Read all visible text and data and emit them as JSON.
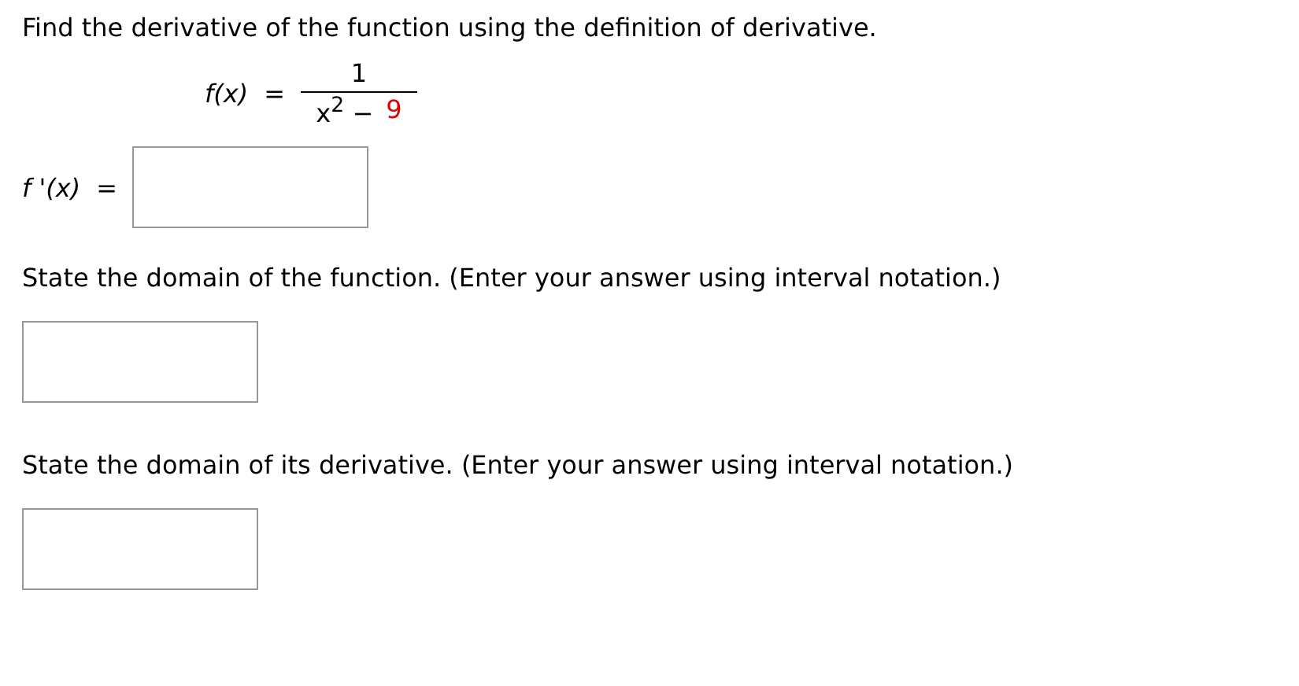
{
  "instruction": "Find the derivative of the function using the definition of derivative.",
  "function": {
    "lhs": "f(x)",
    "equals": "=",
    "numerator": "1",
    "denominator": [
      {
        "text": "x$^{2}$ −",
        "highlight": false
      },
      {
        "text": "9",
        "highlight": true
      }
    ]
  },
  "derivative_answer": {
    "label": "f '(x)",
    "equals": "="
  },
  "questions": [
    {
      "prompt": "State the domain of the function. (Enter your answer using interval notation.)"
    },
    {
      "prompt": "State the domain of its derivative. (Enter your answer using interval notation.)"
    }
  ]
}
